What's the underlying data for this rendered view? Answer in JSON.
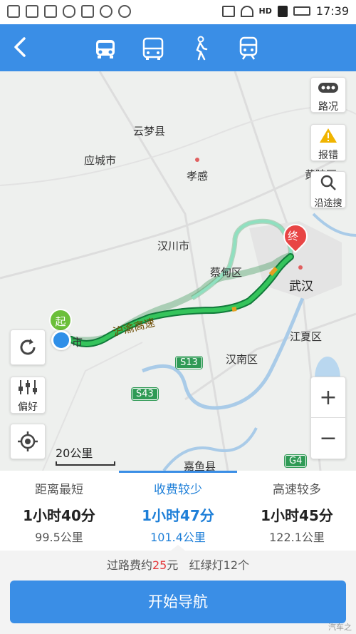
{
  "status_bar": {
    "time": "17:39",
    "network_label": "HD"
  },
  "top_nav": {
    "modes": [
      "car-mode",
      "bus-mode",
      "walk-mode",
      "train-mode"
    ],
    "active_mode": "car-mode"
  },
  "map": {
    "places": {
      "yunmeng": "云梦县",
      "yingcheng": "应城市",
      "xiaogan": "孝感",
      "huangpi": "黄陂区",
      "hanchuan": "汉川市",
      "caidian": "蔡甸区",
      "wuhan": "武汉",
      "jiangxia": "江夏区",
      "hannan": "汉南区",
      "jiayu": "嘉鱼县",
      "start_city": "市",
      "highway": "沪渝高速"
    },
    "road_signs": {
      "s13": "S13",
      "s43": "S43",
      "g4": "G4"
    },
    "markers": {
      "start": "起",
      "end": "终"
    },
    "buttons": {
      "traffic": "路况",
      "report": "报错",
      "search_along": "沿途搜",
      "preference": "偏好",
      "zoom_in": "+",
      "zoom_out": "−"
    },
    "scale": "20公里"
  },
  "routes": [
    {
      "name": "距离最短",
      "time": "1小时40分",
      "distance": "99.5公里",
      "active": false
    },
    {
      "name": "收费较少",
      "time": "1小时47分",
      "distance": "101.4公里",
      "active": true
    },
    {
      "name": "高速较多",
      "time": "1小时45分",
      "distance": "122.1公里",
      "active": false
    }
  ],
  "toll_info": {
    "prefix": "过路费约",
    "amount": "25",
    "unit": "元",
    "lights": "红绿灯12个"
  },
  "navigate_button": "开始导航",
  "watermark": "汽车之"
}
